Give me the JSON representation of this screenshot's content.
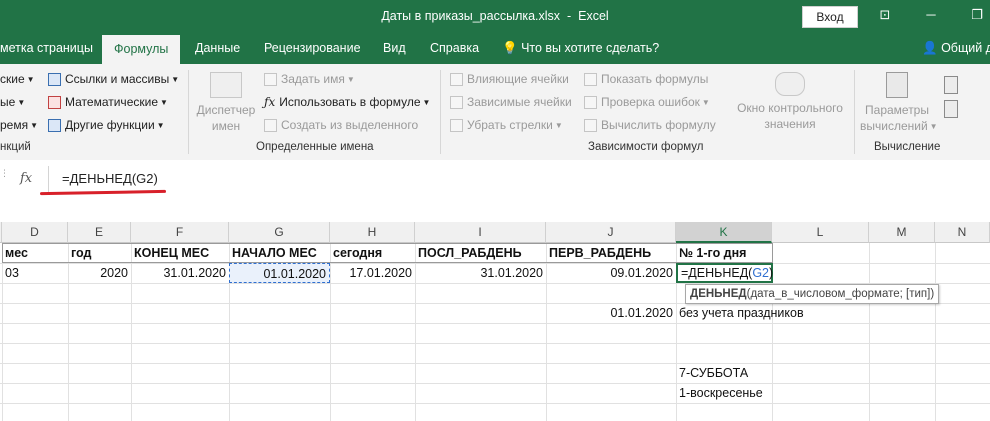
{
  "window": {
    "title": "Даты в приказы_рассылка.xlsx  -  Excel",
    "signin": "Вход"
  },
  "tabs": [
    {
      "label": "метка страницы",
      "active": false
    },
    {
      "label": "Формулы",
      "active": true
    },
    {
      "label": "Данные",
      "active": false
    },
    {
      "label": "Рецензирование",
      "active": false
    },
    {
      "label": "Вид",
      "active": false
    },
    {
      "label": "Справка",
      "active": false
    },
    {
      "label": "Что вы хотите сделать?",
      "active": false
    }
  ],
  "share": "Общий д",
  "ribbon": {
    "lib_left": [
      "ские",
      "ые",
      "ремя"
    ],
    "lib_right": [
      "Ссылки и массивы",
      "Математические",
      "Другие функции"
    ],
    "lib_group": "нкций",
    "names_manager": [
      "Диспетчер",
      "имен"
    ],
    "names_items": [
      "Задать имя",
      "Использовать в формуле",
      "Создать из выделенного"
    ],
    "names_group": "Определенные имена",
    "audit_col1": [
      "Влияющие ячейки",
      "Зависимые ячейки",
      "Убрать стрелки"
    ],
    "audit_col2": [
      "Показать формулы",
      "Проверка ошибок",
      "Вычислить формулу"
    ],
    "watch": [
      "Окно контрольного",
      "значения"
    ],
    "audit_group": "Зависимости формул",
    "calc_options": [
      "Параметры",
      "вычислений"
    ],
    "calc_group": "Вычисление"
  },
  "formula_bar": {
    "fx": "fx",
    "formula": "=ДЕНЬНЕД(G2)"
  },
  "grid": {
    "columns": [
      "D",
      "E",
      "F",
      "G",
      "H",
      "I",
      "J",
      "K",
      "L",
      "M",
      "N"
    ],
    "selected_column": "K",
    "row1": [
      "мес",
      "год",
      "КОНЕЦ МЕС",
      "НАЧАЛО МЕС",
      "сегодня",
      "ПОСЛ_РАБДЕНЬ",
      "ПЕРВ_РАБДЕНЬ",
      "№ 1-го дня"
    ],
    "row2": [
      "03",
      "2020",
      "31.01.2020",
      "01.01.2020",
      "17.01.2020",
      "31.01.2020",
      "09.01.2020"
    ],
    "editing_prefix": "=ДЕНЬНЕД(",
    "editing_ref": "G2",
    "editing_suffix": ")",
    "tooltip_fn": "ДЕНЬНЕД",
    "tooltip_args": "(дата_в_числовом_формате; [тип])",
    "row4_j": "01.01.2020",
    "row4_k": "без учета праздников",
    "row7_k": "7-СУББОТА",
    "row8_k": "1-воскресенье"
  },
  "colors": {
    "excel_green": "#217346",
    "ref_blue": "#2f6fd0",
    "annotation_red": "#d8202a"
  }
}
